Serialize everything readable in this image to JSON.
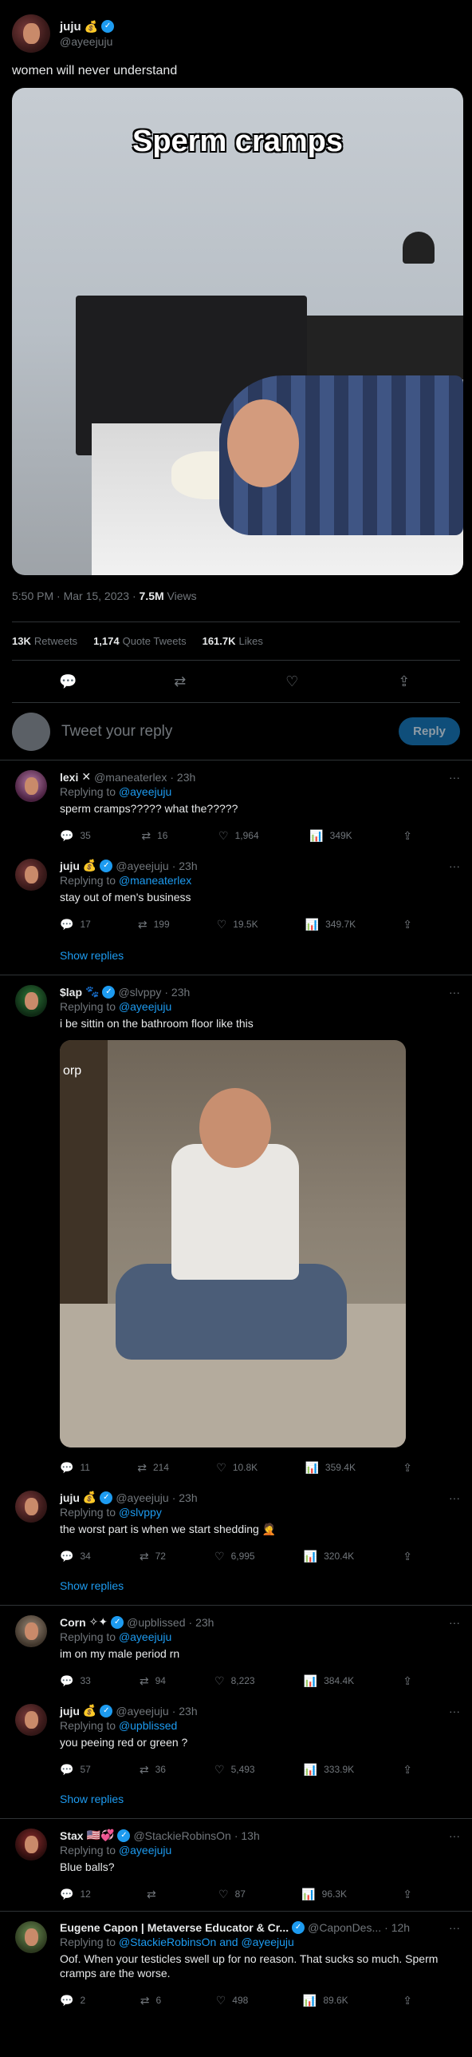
{
  "main_tweet": {
    "name": "juju",
    "emoji": "💰",
    "handle": "@ayeejuju",
    "text": "women will never understand",
    "media_caption": "Sperm cramps",
    "timestamp": "5:50 PM · Mar 15, 2023 · ",
    "views_value": "7.5M",
    "views_label": "Views",
    "stats": {
      "retweets_value": "13K",
      "retweets_label": "Retweets",
      "quotes_value": "1,174",
      "quotes_label": "Quote Tweets",
      "likes_value": "161.7K",
      "likes_label": "Likes"
    },
    "action_icons": [
      "reply-icon",
      "retweet-icon",
      "like-icon",
      "share-icon"
    ]
  },
  "reply_box": {
    "placeholder": "Tweet your reply",
    "button_label": "Reply"
  },
  "replies": [
    {
      "name": "lexi",
      "badge": "✕",
      "handle": "@maneaterlex",
      "time": "· 23h",
      "replying_prefix": "Replying to ",
      "replying_to": "@ayeejuju",
      "text": "sperm cramps????? what the?????",
      "reply_count": "35",
      "retweets": "16",
      "likes": "1,964",
      "views": "349K"
    },
    {
      "name": "juju",
      "badge": "💰",
      "handle": "@ayeejuju",
      "time": "· 23h",
      "replying_prefix": "Replying to ",
      "replying_to": "@maneaterlex",
      "text": "stay out of men's business",
      "reply_count": "17",
      "retweets": "199",
      "likes": "19.5K",
      "views": "349.7K"
    },
    {
      "name": "$lap",
      "badge": "🐾",
      "handle": "@slvppy",
      "time": "· 23h",
      "replying_prefix": "Replying to ",
      "replying_to": "@ayeejuju",
      "text": "i be sittin on the bathroom floor like this",
      "media_overlay": "orp",
      "reply_count": "11",
      "retweets": "214",
      "likes": "10.8K",
      "views": "359.4K"
    },
    {
      "name": "juju",
      "badge": "💰",
      "handle": "@ayeejuju",
      "time": "· 23h",
      "replying_prefix": "Replying to ",
      "replying_to": "@slvppy",
      "text": "the worst part is when we start shedding 🤦",
      "reply_count": "34",
      "retweets": "72",
      "likes": "6,995",
      "views": "320.4K"
    },
    {
      "name": "Corn",
      "badge": "✧✦",
      "handle": "@upblissed",
      "time": "· 23h",
      "replying_prefix": "Replying to ",
      "replying_to": "@ayeejuju",
      "text": "im on my male period rn",
      "reply_count": "33",
      "retweets": "94",
      "likes": "8,223",
      "views": "384.4K"
    },
    {
      "name": "juju",
      "badge": "💰",
      "handle": "@ayeejuju",
      "time": "· 23h",
      "replying_prefix": "Replying to ",
      "replying_to": "@upblissed",
      "text": "you peeing red or green ?",
      "reply_count": "57",
      "retweets": "36",
      "likes": "5,493",
      "views": "333.9K"
    },
    {
      "name": "Stax",
      "badge": "🇺🇸💞",
      "handle": "@StackieRobinsOn",
      "time": "· 13h",
      "replying_prefix": "Replying to ",
      "replying_to": "@ayeejuju",
      "text": "Blue balls?",
      "reply_count": "12",
      "retweets": "",
      "likes": "87",
      "views": "96.3K"
    },
    {
      "name": "Eugene Capon | Metaverse Educator & Cr...",
      "badge": "",
      "handle": "@CaponDes...",
      "time": "· 12h",
      "replying_prefix": "Replying to ",
      "replying_to": "@StackieRobinsOn and @ayeejuju",
      "text": "Oof. When your testicles swell up for no reason. That sucks so much. Sperm cramps are the worse.",
      "reply_count": "2",
      "retweets": "6",
      "likes": "498",
      "views": "89.6K"
    }
  ],
  "show_replies_label": "Show replies",
  "more_label": "···",
  "icons": {
    "reply": "💬",
    "retweet": "⇄",
    "like": "♡",
    "views": "📊",
    "share": "⇪"
  }
}
